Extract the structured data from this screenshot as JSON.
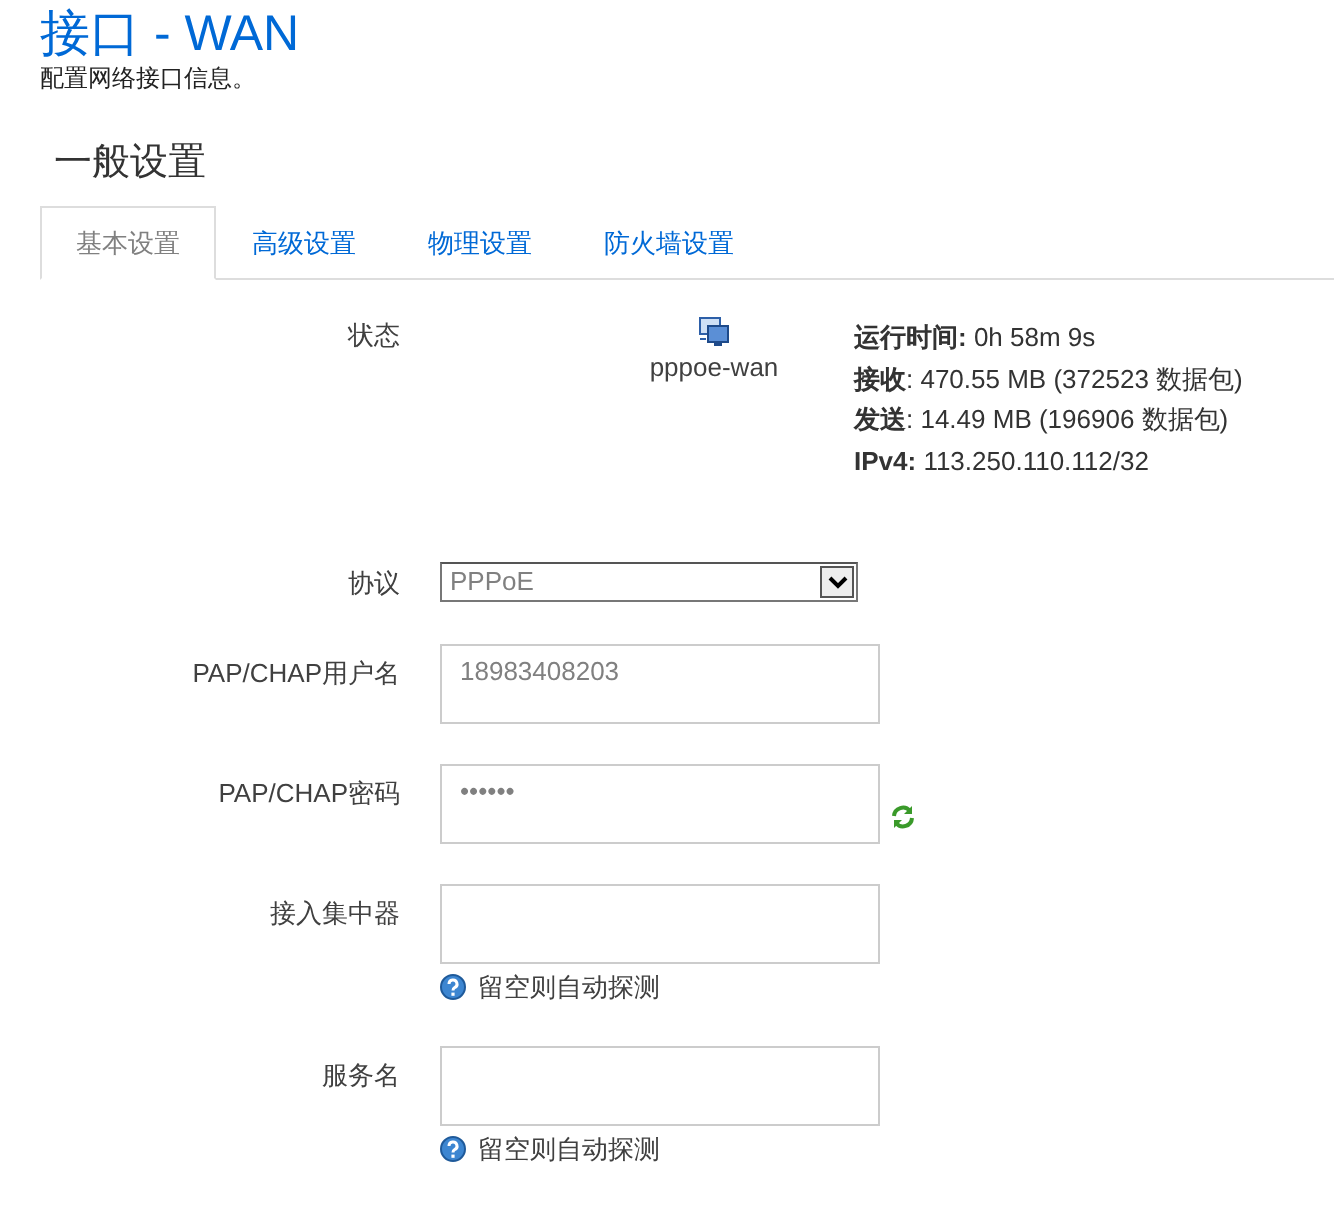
{
  "page": {
    "title": "接口 - WAN",
    "description": "配置网络接口信息。"
  },
  "section": {
    "title": "一般设置"
  },
  "tabs": [
    {
      "label": "基本设置",
      "selected": true
    },
    {
      "label": "高级设置",
      "selected": false
    },
    {
      "label": "物理设置",
      "selected": false
    },
    {
      "label": "防火墙设置",
      "selected": false
    }
  ],
  "status": {
    "label": "状态",
    "interface": "pppoe-wan",
    "info": [
      "**运行时间:** 0h 58m 9s",
      "**接收**: 470.55 MB (372523 数据包)",
      "**发送**: 14.49 MB (196906 数据包)",
      "**IPv4:** 113.250.110.112/32"
    ]
  },
  "fields": [
    {
      "kind": "select",
      "label": "协议",
      "value": "PPPoE"
    },
    {
      "kind": "text",
      "label": "PAP/CHAP用户名",
      "value": "18983408203"
    },
    {
      "kind": "password",
      "label": "PAP/CHAP密码",
      "value": "••••••"
    },
    {
      "kind": "text",
      "label": "接入集中器",
      "hint": "留空则自动探测"
    },
    {
      "kind": "text",
      "label": "服务名",
      "hint": "留空则自动探测"
    }
  ]
}
